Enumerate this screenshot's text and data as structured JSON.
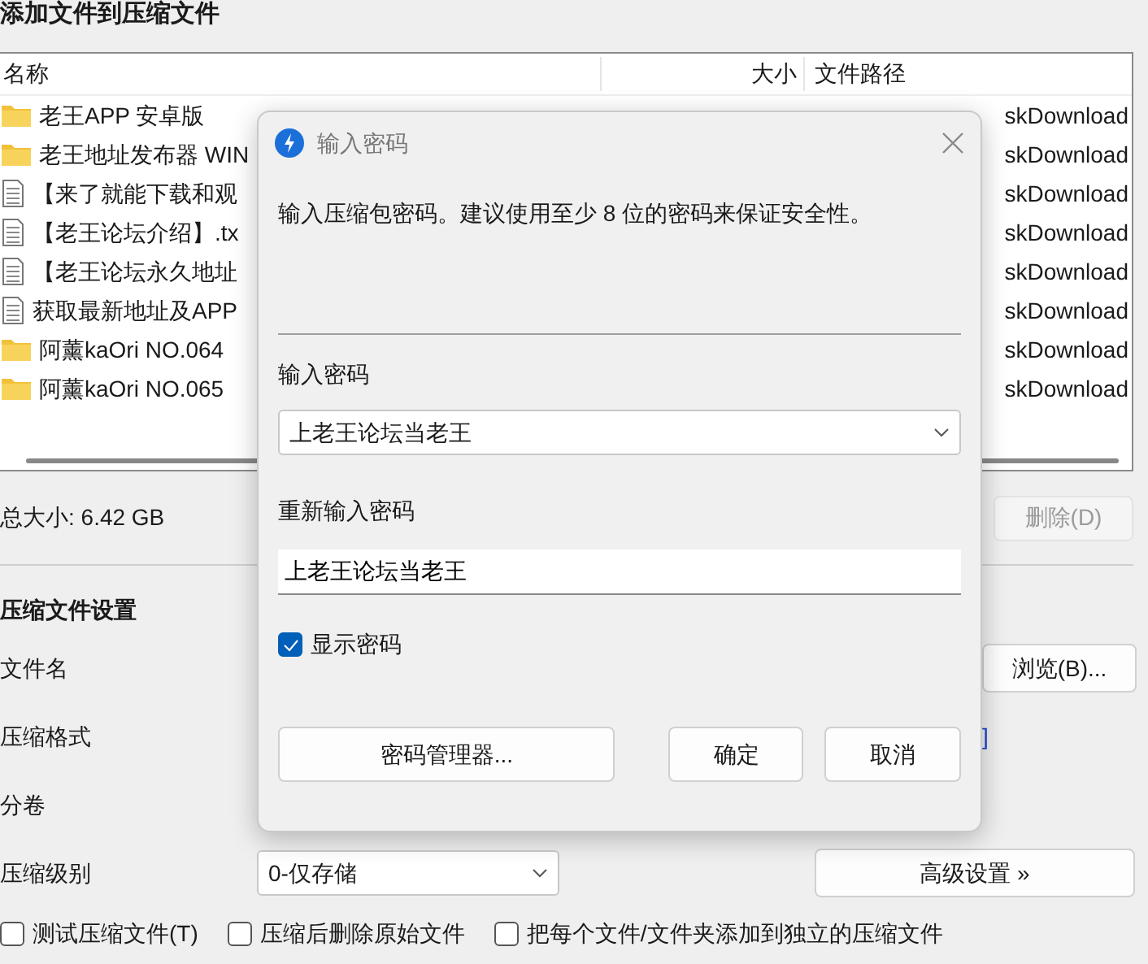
{
  "window": {
    "title": "添加文件到压缩文件"
  },
  "file_list": {
    "columns": [
      "名称",
      "大小",
      "文件路径"
    ],
    "rows": [
      {
        "kind": "folder",
        "name": "老王APP 安卓版",
        "path": "skDownload"
      },
      {
        "kind": "folder",
        "name": "老王地址发布器 WIN",
        "path": "skDownload"
      },
      {
        "kind": "file",
        "name": "【来了就能下载和观",
        "path": "skDownload"
      },
      {
        "kind": "file",
        "name": "【老王论坛介绍】.tx",
        "path": "skDownload"
      },
      {
        "kind": "file",
        "name": "【老王论坛永久地址",
        "path": "skDownload"
      },
      {
        "kind": "file",
        "name": "获取最新地址及APP",
        "path": "skDownload"
      },
      {
        "kind": "folder",
        "name": "阿薰kaOri NO.064",
        "path": "skDownload"
      },
      {
        "kind": "folder",
        "name": "阿薰kaOri NO.065",
        "path": "skDownload"
      }
    ]
  },
  "total_size": "总大小: 6.42 GB",
  "delete_button": {
    "label": "删除(D)",
    "disabled": true
  },
  "settings": {
    "title": "压缩文件设置",
    "fields": [
      {
        "label": "文件名",
        "button": "浏览(B)..."
      },
      {
        "label": "压缩格式",
        "link": "]"
      },
      {
        "label": "分卷"
      },
      {
        "label": "压缩级别",
        "value": "0-仅存储",
        "button": "高级设置 »"
      }
    ]
  },
  "options": [
    {
      "label": "测试压缩文件(T)",
      "checked": false
    },
    {
      "label": "压缩后删除原始文件",
      "checked": false
    },
    {
      "label": "把每个文件/文件夹添加到独立的压缩文件",
      "checked": false
    }
  ],
  "dialog": {
    "title": "输入密码",
    "description": "输入压缩包密码。建议使用至少 8 位的密码来保证安全性。",
    "password_label": "输入密码",
    "password_value": "上老王论坛当老王",
    "confirm_label": "重新输入密码",
    "confirm_value": "上老王论坛当老王",
    "show_password": {
      "label": "显示密码",
      "checked": true
    },
    "buttons": [
      {
        "kind": "manager",
        "label": "密码管理器..."
      },
      {
        "kind": "ok",
        "label": "确定"
      },
      {
        "kind": "cancel",
        "label": "取消"
      }
    ]
  }
}
